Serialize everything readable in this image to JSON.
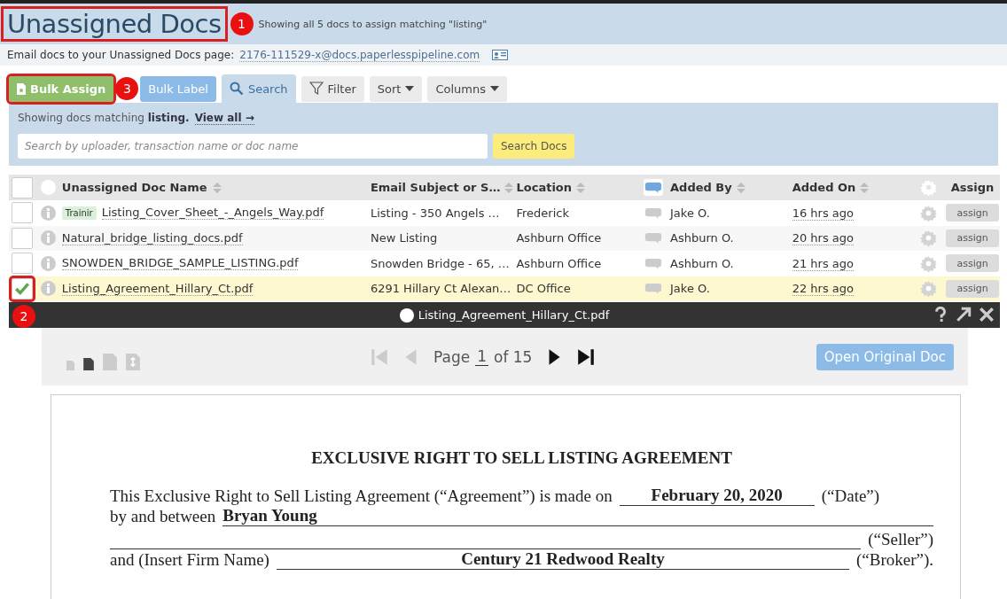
{
  "header": {
    "title": "Unassigned Docs",
    "title_highlighted": true,
    "badge": "1",
    "subtitle": "Showing all 5 docs to assign matching \"listing\""
  },
  "email_row": {
    "label": "Email docs to your Unassigned Docs page:",
    "address": "2176-111529-x@docs.paperlesspipeline.com"
  },
  "toolbar": [
    {
      "kind": "assign",
      "label": "Bulk Assign",
      "highlighted": true,
      "badge": "3"
    },
    {
      "kind": "label",
      "label": "Bulk Label",
      "highlighted": false
    },
    {
      "kind": "search",
      "label": "Search",
      "highlighted": false,
      "selected": true
    },
    {
      "kind": "filter",
      "label": "Filter",
      "highlighted": false
    },
    {
      "kind": "dropdown",
      "label": "Sort",
      "highlighted": false
    },
    {
      "kind": "dropdown",
      "label": "Columns",
      "highlighted": false
    }
  ],
  "search_panel": {
    "prefix": "Showing docs matching",
    "term": "listing.",
    "view_all": "View all →",
    "placeholder": "Search by uploader, transaction name or doc name",
    "button": "Search Docs"
  },
  "table": {
    "select_all_checked": false,
    "columns": [
      "Unassigned Doc Name",
      "Email Subject or S…",
      "Location",
      "Added By",
      "Added On",
      "Assign"
    ],
    "rows": [
      {
        "checked": false,
        "tag": "Trainir",
        "name": "Listing_Cover_Sheet_-_Angels_Way.pdf",
        "subject": "Listing - 350 Angels …",
        "location": "Frederick",
        "added_by": "Jake O.",
        "added_on": "16 hrs ago",
        "action": "assign",
        "highlighted": false
      },
      {
        "checked": false,
        "name": "Natural_bridge_listing_docs.pdf",
        "subject": "New Listing",
        "location": "Ashburn Office",
        "added_by": "Ashburn O.",
        "added_on": "20 hrs ago",
        "action": "assign",
        "highlighted": false
      },
      {
        "checked": false,
        "name": "SNOWDEN_BRIDGE_SAMPLE_LISTING.pdf",
        "subject": "Snowden Bridge - 65, …",
        "location": "Ashburn Office",
        "added_by": "Ashburn O.",
        "added_on": "21 hrs ago",
        "action": "assign",
        "highlighted": false
      },
      {
        "checked": true,
        "name": "Listing_Agreement_Hillary_Ct.pdf",
        "subject": "6291 Hillary Ct Alexan…",
        "location": "DC Office",
        "added_by": "Jake O.",
        "added_on": "22 hrs ago",
        "action": "assign",
        "highlighted": true,
        "badge": "2"
      }
    ]
  },
  "viewer": {
    "title": "Listing_Agreement_Hillary_Ct.pdf",
    "page_label": "Page",
    "page": "1",
    "of_label": "of 15",
    "open_button": "Open Original Doc",
    "document": {
      "heading": "EXCLUSIVE RIGHT TO SELL LISTING AGREEMENT",
      "line1": "This Exclusive Right to Sell Listing Agreement (“Agreement”) is made on",
      "date": "February 20, 2020",
      "date_label": "(“Date”)",
      "line2": "by and between",
      "seller_name": "Bryan Young",
      "seller_label": "(“Seller”)",
      "firm_label": "and (Insert Firm Name)",
      "firm": "Century 21 Redwood Realty",
      "broker_label": "(“Broker”)."
    }
  }
}
